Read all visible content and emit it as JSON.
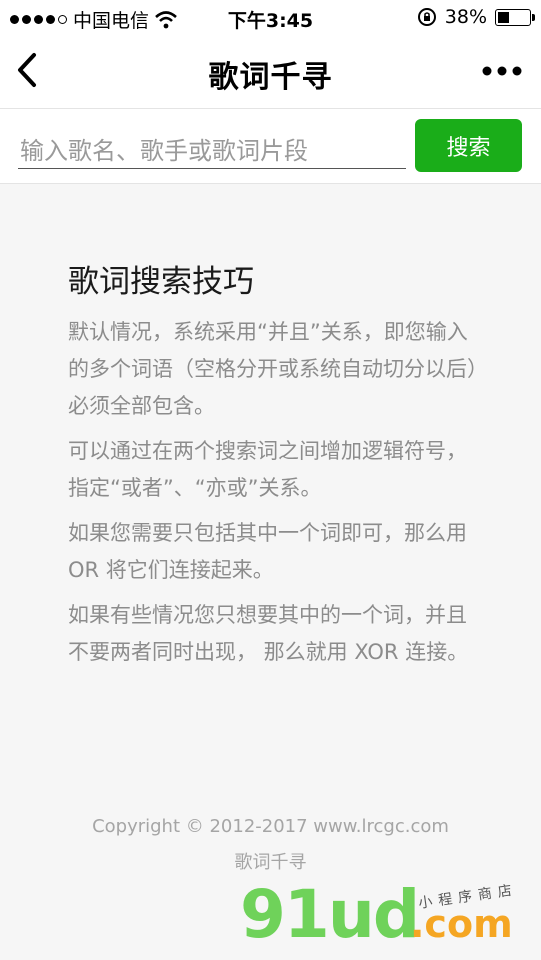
{
  "status_bar": {
    "carrier": "中国电信",
    "time": "下午3:45",
    "battery_percent": "38%",
    "battery_level": 0.38
  },
  "nav": {
    "title": "歌词千寻",
    "back_icon": "chevron-left-icon",
    "more_icon": "more-dots-icon"
  },
  "search": {
    "placeholder": "输入歌名、歌手或歌词片段",
    "button_label": "搜索",
    "button_color": "#1aad19"
  },
  "tips": {
    "title": "歌词搜索技巧",
    "paragraphs": [
      "默认情况，系统采用“并且”关系，即您输入的多个词语（空格分开或系统自动切分以后）必须全部包含。",
      "可以通过在两个搜索词之间增加逻辑符号，指定“或者”、“亦或”关系。",
      " 如果您需要只包括其中一个词即可，那么用 OR 将它们连接起来。",
      " 如果有些情况您只想要其中的一个词，并且不要两者同时出现， 那么就用 XOR 连接。"
    ]
  },
  "footer": {
    "copyright": "Copyright © 2012-2017 www.lrcgc.com",
    "app_name": "歌词千寻"
  },
  "watermark": {
    "logo": "91ud",
    "domain": ".com",
    "tagline": "小程序商店"
  }
}
